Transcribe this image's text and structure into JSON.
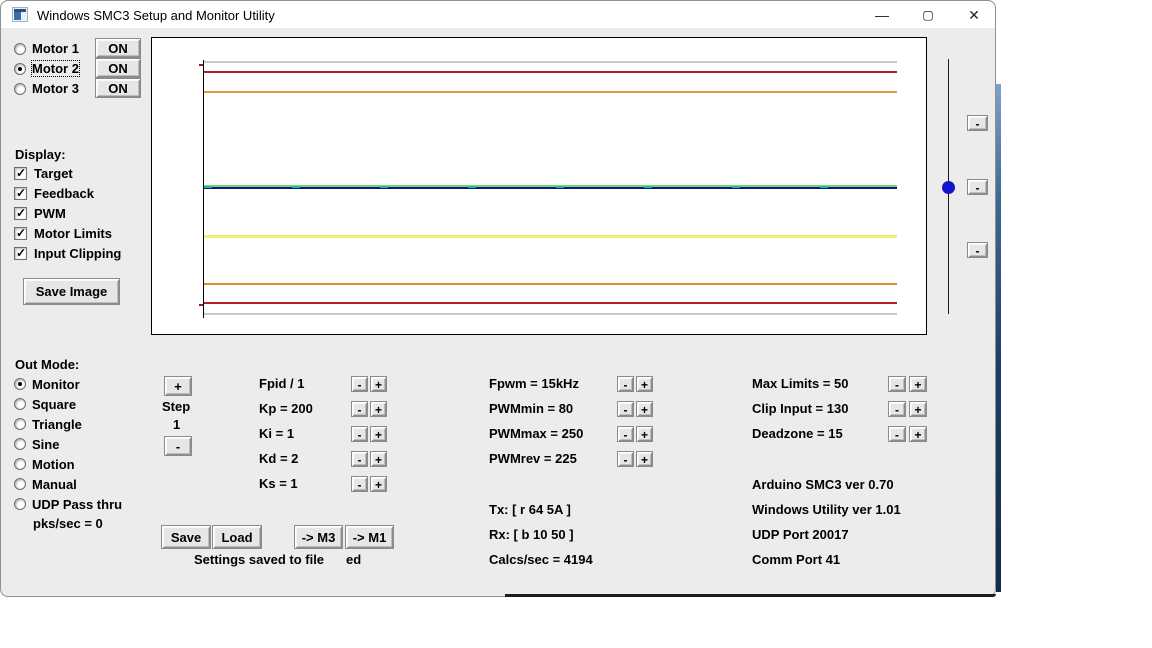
{
  "window": {
    "title": "Windows SMC3 Setup and Monitor Utility",
    "minimize_glyph": "—",
    "maximize_glyph": "▢",
    "close_glyph": "✕"
  },
  "motors": {
    "items": [
      {
        "label": "Motor 1",
        "button": "ON",
        "selected": false
      },
      {
        "label": "Motor 2",
        "button": "ON",
        "selected": true
      },
      {
        "label": "Motor 3",
        "button": "ON",
        "selected": false
      }
    ]
  },
  "display": {
    "heading": "Display:",
    "items": [
      {
        "label": "Target",
        "checked": true
      },
      {
        "label": "Feedback",
        "checked": true
      },
      {
        "label": "PWM",
        "checked": true
      },
      {
        "label": "Motor Limits",
        "checked": true
      },
      {
        "label": "Input Clipping",
        "checked": true
      }
    ],
    "save_image_label": "Save Image"
  },
  "out_mode": {
    "heading": "Out Mode:",
    "options": [
      {
        "label": "Monitor",
        "selected": true
      },
      {
        "label": "Square",
        "selected": false
      },
      {
        "label": "Triangle",
        "selected": false
      },
      {
        "label": "Sine",
        "selected": false
      },
      {
        "label": "Motion",
        "selected": false
      },
      {
        "label": "Manual",
        "selected": false
      },
      {
        "label": "UDP Pass thru",
        "selected": false
      }
    ],
    "pks_text": "pks/sec = 0"
  },
  "step": {
    "plus_label": "+",
    "label": "Step",
    "value": "1",
    "minus_label": "-"
  },
  "spinner": {
    "minus": "-",
    "plus": "+"
  },
  "pid_params": {
    "rows": [
      {
        "label": "Fpid / 1"
      },
      {
        "label": "Kp = 200"
      },
      {
        "label": "Ki = 1"
      },
      {
        "label": "Kd = 2"
      },
      {
        "label": "Ks = 1"
      }
    ]
  },
  "pwm_params": {
    "rows": [
      {
        "label": "Fpwm = 15kHz"
      },
      {
        "label": "PWMmin = 80"
      },
      {
        "label": "PWMmax = 250"
      },
      {
        "label": "PWMrev = 225"
      }
    ]
  },
  "limit_params": {
    "rows": [
      {
        "label": "Max Limits = 50"
      },
      {
        "label": "Clip Input = 130"
      },
      {
        "label": "Deadzone = 15"
      }
    ]
  },
  "comms": {
    "tx": "Tx: [ r 64 5A ]",
    "rx": "Rx: [ b 10 50 ]",
    "calcs": "Calcs/sec = 4194"
  },
  "info": {
    "lines": [
      "Arduino SMC3 ver 0.70",
      "Windows Utility ver 1.01",
      "UDP Port 20017",
      "Comm Port 41"
    ]
  },
  "file_actions": {
    "save": "Save",
    "load": "Load",
    "to_m3": "-> M3",
    "to_m1": "-> M1",
    "status": "Settings saved to file",
    "status_fragment": "ed"
  },
  "scope": {
    "lines": [
      {
        "name": "frame-top",
        "y": 23,
        "h": 2,
        "color": "#c9c9c9",
        "dashed": false
      },
      {
        "name": "clip-upper",
        "y": 33,
        "h": 2,
        "color": "#b22222",
        "dashed": false
      },
      {
        "name": "limit-upper",
        "y": 53,
        "h": 2,
        "color": "#e09a3c",
        "dashed": false
      },
      {
        "name": "target",
        "y": 147,
        "h": 2,
        "color": "#6ade6a",
        "dashed": false
      },
      {
        "name": "feedback",
        "y": 149,
        "h": 2,
        "color": "#17177f",
        "dashed": false
      },
      {
        "name": "feedback-dashes",
        "y": 148,
        "h": 2,
        "color": "#2ab59f",
        "dashed": true
      },
      {
        "name": "pwm",
        "y": 197,
        "h": 3,
        "color": "#efef6a",
        "dashed": false
      },
      {
        "name": "limit-lower",
        "y": 245,
        "h": 2,
        "color": "#de8a2e",
        "dashed": false
      },
      {
        "name": "clip-lower",
        "y": 264,
        "h": 2,
        "color": "#b22222",
        "dashed": false
      },
      {
        "name": "frame-bottom",
        "y": 275,
        "h": 2,
        "color": "#c9c9c9",
        "dashed": false
      }
    ]
  },
  "chart_data": {
    "type": "line",
    "title": "SMC3 motor scope (Motor 2) — flat traces",
    "xlabel": "",
    "ylabel": "",
    "legend_position": "none",
    "grid": false,
    "series": [
      {
        "name": "Input Clipping upper (red)",
        "values": "constant, clip input = 130"
      },
      {
        "name": "Motor Limit upper (orange)",
        "values": "constant, max limits = 50"
      },
      {
        "name": "Target (green)",
        "values": "constant at center"
      },
      {
        "name": "Feedback (dark blue/teal)",
        "values": "constant at center, overlapping target"
      },
      {
        "name": "PWM (yellow)",
        "values": "constant below center"
      },
      {
        "name": "Motor Limit lower (orange)",
        "values": "constant, max limits = 50"
      },
      {
        "name": "Input Clipping lower (red)",
        "values": "constant, clip input = 130"
      }
    ]
  }
}
